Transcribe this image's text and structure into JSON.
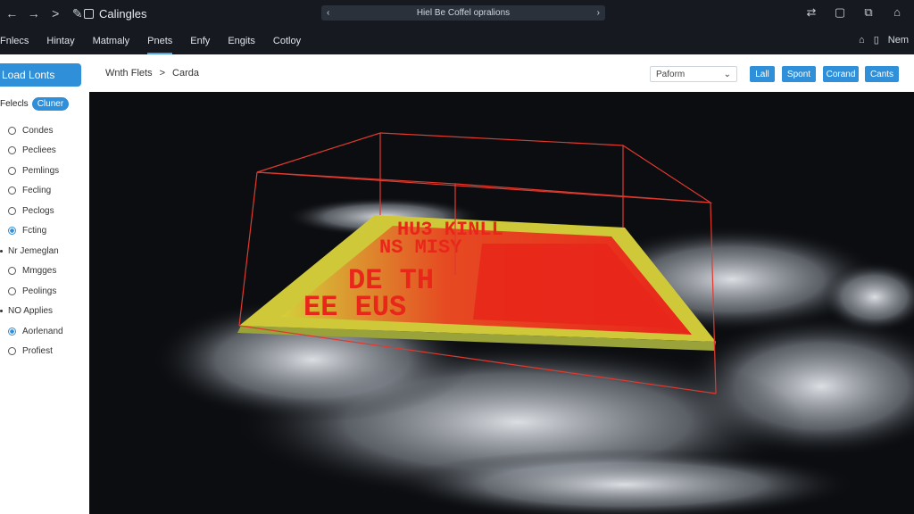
{
  "titlebar": {
    "title": "Calingles",
    "address": "Hiel Be Coffel opralions",
    "nav_back": "←",
    "nav_forward": "→",
    "nav_next": ">",
    "edit": "✎",
    "addr_prev": "‹",
    "addr_next": "›",
    "actions": [
      "⇄",
      "▢",
      "⧉",
      "⌂"
    ]
  },
  "menubar": {
    "items": [
      "Fnlecs",
      "Hintay",
      "Matmaly",
      "Pnets",
      "Enfy",
      "Engits",
      "Cotloy"
    ],
    "active_index": 3,
    "right_home": "⌂",
    "right_label": "Nem"
  },
  "sidebar": {
    "load_button": "Load Lonts",
    "filter_label": "Felecls",
    "filter_chip": "Cluner",
    "rows": [
      {
        "type": "radio",
        "label": "Condes",
        "checked": false
      },
      {
        "type": "radio",
        "label": "Pecliees",
        "checked": false
      },
      {
        "type": "radio",
        "label": "Pemlings",
        "checked": false
      },
      {
        "type": "radio",
        "label": "Fecling",
        "checked": false
      },
      {
        "type": "radio",
        "label": "Peclogs",
        "checked": false
      },
      {
        "type": "radio",
        "label": "Fcting",
        "checked": true
      },
      {
        "type": "header",
        "label": "Nr Jemeglan"
      },
      {
        "type": "radio",
        "label": "Mmgges",
        "checked": false
      },
      {
        "type": "radio",
        "label": "Peolings",
        "checked": false
      },
      {
        "type": "header",
        "label": "NO Applies"
      },
      {
        "type": "radio",
        "label": "Aorlenand",
        "checked": true
      },
      {
        "type": "radio",
        "label": "Profiest",
        "checked": false
      }
    ]
  },
  "toolbar": {
    "breadcrumb_root": "Wnth Flets",
    "breadcrumb_sep": ">",
    "breadcrumb_leaf": "Carda",
    "select_value": "Paform",
    "buttons": [
      "Lall",
      "Spont",
      "Corand",
      "Cants"
    ]
  },
  "viewport": {
    "overlay_text": [
      "HU3 KINLL",
      "NS MISY",
      "DE TH",
      "EE EUS"
    ]
  },
  "colors": {
    "accent": "#2f8fd8",
    "bbox": "#e03a2e",
    "heat_red": "#e8261a",
    "heat_yellow": "#d8d33a"
  }
}
